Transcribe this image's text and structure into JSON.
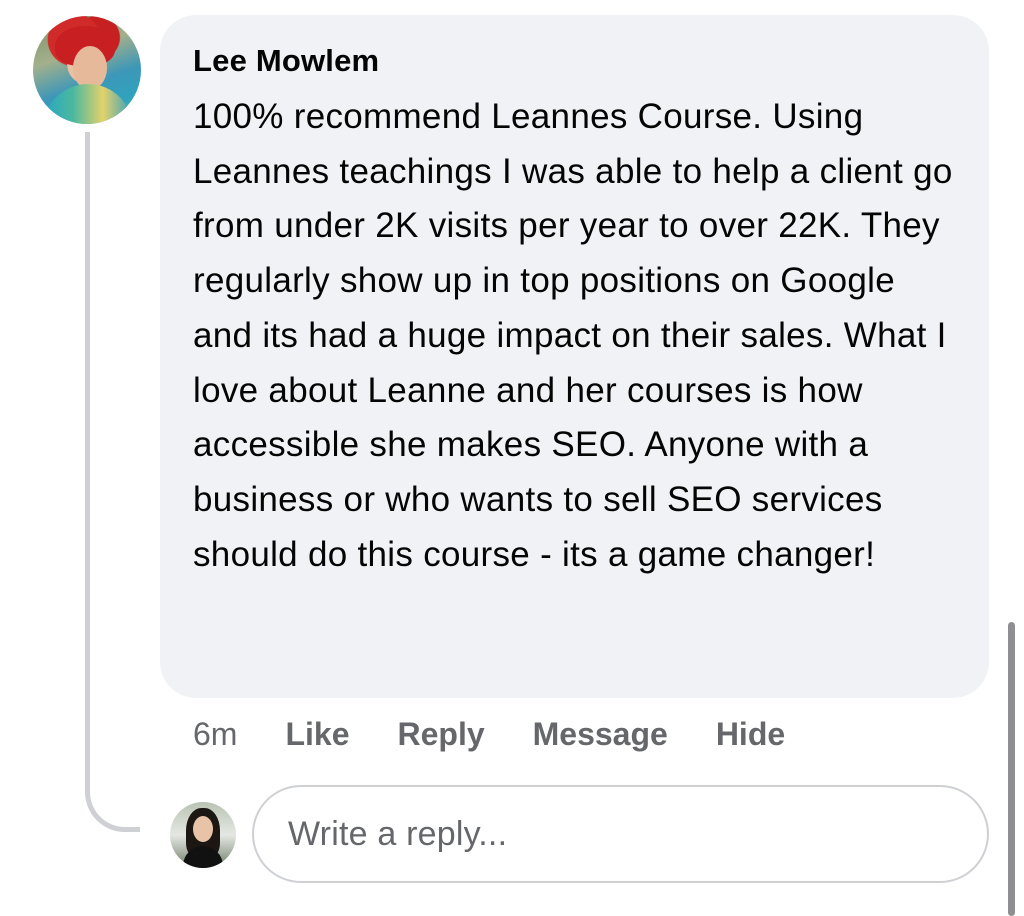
{
  "comment": {
    "author": "Lee Mowlem",
    "text": "100% recommend Leannes Course. Using Leannes teachings I was able to help a client go from under 2K visits per year to over 22K. They regularly show up in top positions on Google and its had a huge impact on their sales. What I love about Leanne and her courses is how accessible she makes SEO. Anyone with a business or who wants to sell SEO services should do this course - its a game changer!",
    "time": "6m",
    "actions": {
      "like": "Like",
      "reply": "Reply",
      "message": "Message",
      "hide": "Hide"
    }
  },
  "reply_box": {
    "placeholder": "Write a reply..."
  },
  "colors": {
    "bubble_background": "#f0f2f5",
    "secondary_text": "#65676b",
    "primary_text": "#050505",
    "border": "#ced0d4"
  }
}
